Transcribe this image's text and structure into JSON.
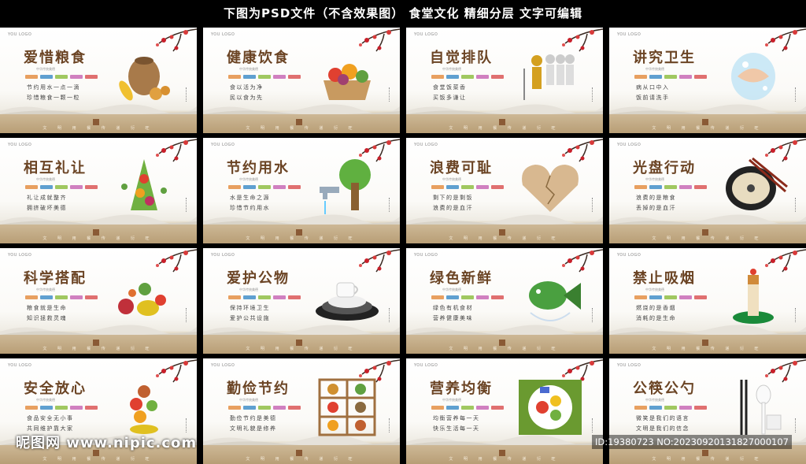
{
  "banner": "下图为PSD文件（不含效果图）   食堂文化  精细分层  文字可编辑",
  "logo": "YOU LOGO",
  "subtitle": "中华传统美德",
  "footer": "文 明 用 餐   传 递 衍 旺",
  "tag_colors": [
    "#e8a060",
    "#5fa0d0",
    "#a0c860",
    "#d080c0",
    "#e07070"
  ],
  "cards": [
    {
      "title": "爱惜粮食",
      "line1": "节约用水一点一滴",
      "line2": "珍惜粮食一颗一粒",
      "icon": "grain-sack-icon"
    },
    {
      "title": "健康饮食",
      "line1": "食以活为净",
      "line2": "民以食为先",
      "icon": "vegetable-basket-icon"
    },
    {
      "title": "自觉排队",
      "line1": "食堂饭菜香",
      "line2": "买饭多谦让",
      "icon": "queue-people-icon"
    },
    {
      "title": "讲究卫生",
      "line1": "病从口中入",
      "line2": "饭前请洗手",
      "icon": "hand-washing-icon"
    },
    {
      "title": "相互礼让",
      "line1": "礼让成就整齐",
      "line2": "拥挤破坏美德",
      "icon": "vegetable-tower-icon"
    },
    {
      "title": "节约用水",
      "line1": "水是生命之源",
      "line2": "珍惜节约用水",
      "icon": "faucet-tree-icon"
    },
    {
      "title": "浪费可耻",
      "line1": "剩下的是剩饭",
      "line2": "浪费的是血汗",
      "icon": "cracked-heart-icon"
    },
    {
      "title": "光盘行动",
      "line1": "浪费的是粮食",
      "line2": "丢掉的是血汗",
      "icon": "plate-chopsticks-icon"
    },
    {
      "title": "科学搭配",
      "line1": "粮食就是生命",
      "line2": "知识拯救灵魂",
      "icon": "fruit-mix-icon"
    },
    {
      "title": "爱护公物",
      "line1": "保持环境卫生",
      "line2": "爱护公共设施",
      "icon": "dishes-stack-icon"
    },
    {
      "title": "绿色新鲜",
      "line1": "绿色有机食材",
      "line2": "营养健康美味",
      "icon": "green-fish-icon"
    },
    {
      "title": "禁止吸烟",
      "line1": "燃烧的是香烟",
      "line2": "消耗的是生命",
      "icon": "cigarette-icon"
    },
    {
      "title": "安全放心",
      "line1": "食品安全无小事",
      "line2": "共同维护靠大家",
      "icon": "food-pile-icon"
    },
    {
      "title": "勤俭节约",
      "line1": "勤俭节约是美德",
      "line2": "文明礼貌是修养",
      "icon": "food-shelf-icon"
    },
    {
      "title": "营养均衡",
      "line1": "均衡营养每一天",
      "line2": "快乐生活每一天",
      "icon": "balanced-plate-icon"
    },
    {
      "title": "公筷公勺",
      "line1": "微笑是我们的语言",
      "line2": "文明是我们的信念",
      "icon": "chopsticks-spoon-icon"
    }
  ],
  "watermark_left": "昵图网 www.nipic.com",
  "watermark_right": "ID:19380723 NO:20230920131827000107"
}
